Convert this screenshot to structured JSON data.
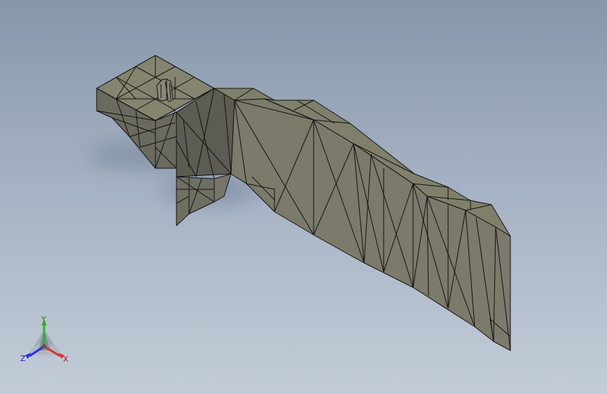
{
  "viewport": {
    "background_top": "#8796ab",
    "background_bottom": "#c3ccd8"
  },
  "model": {
    "name": "meshed-part",
    "face_color": "#7b7a6b",
    "face_color_light": "#85846f",
    "face_color_dark": "#5c5c52",
    "edge_color": "#111111",
    "shadow_color": "#6f7f99"
  },
  "triad": {
    "x_label": "X",
    "y_label": "Y",
    "z_label": "Z",
    "x_color": "#e0302c",
    "y_color": "#2fb02f",
    "z_color": "#2c2ce0",
    "icon": "coordinate-triad-icon"
  }
}
